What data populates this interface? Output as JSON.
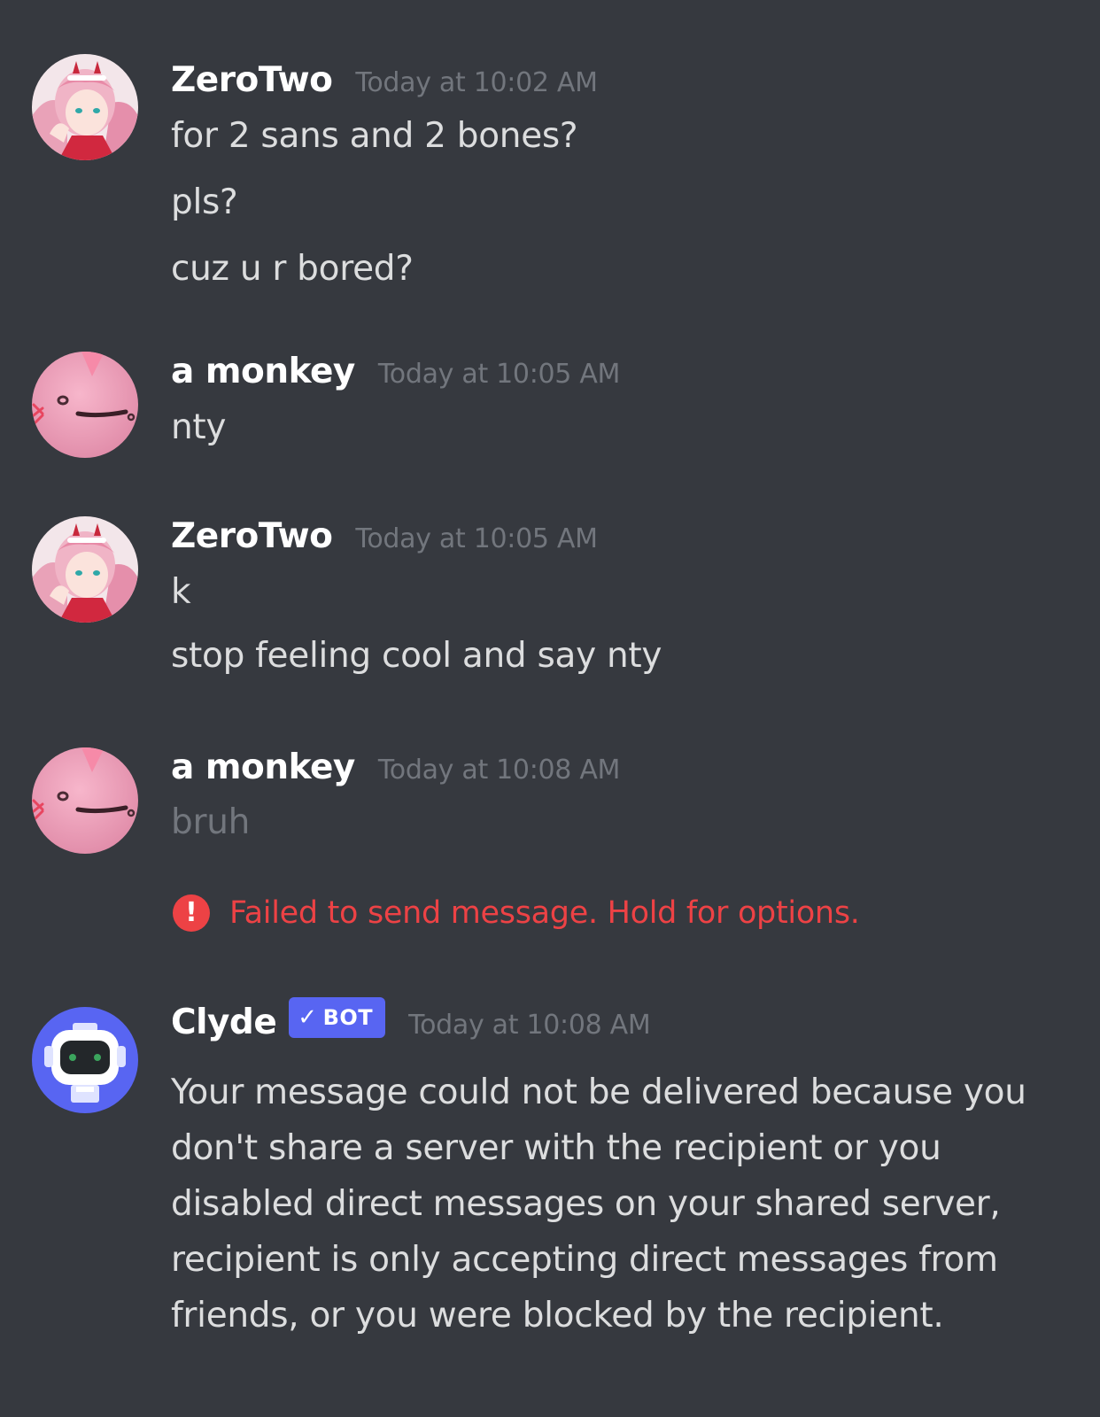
{
  "messages": [
    {
      "author": "ZeroTwo",
      "avatar": "zerotwo-avatar",
      "timestamp": "Today at 10:02 AM",
      "lines": [
        "for 2 sans and 2 bones?",
        "pls?",
        "cuz u r bored?"
      ]
    },
    {
      "author": "a monkey",
      "avatar": "pink-blob-avatar",
      "timestamp": "Today at 10:05 AM",
      "lines": [
        "nty"
      ]
    },
    {
      "author": "ZeroTwo",
      "avatar": "zerotwo-avatar",
      "timestamp": "Today at 10:05 AM",
      "lines": [
        "k",
        "stop feeling cool and say nty"
      ]
    },
    {
      "author": "a monkey",
      "avatar": "pink-blob-avatar",
      "timestamp": "Today at 10:08 AM",
      "lines": [
        "bruh"
      ],
      "error": {
        "icon": "!",
        "text": "Failed to send message. Hold for options."
      }
    },
    {
      "author": "Clyde",
      "avatar": "clyde-robot-avatar",
      "badge": "BOT",
      "timestamp": "Today at 10:08 AM",
      "text": "Your message could not be delivered because you don't share a server with the recipient or you disabled direct messages on your shared server, recipient is only accepting direct messages from friends, or you were blocked by the recipient."
    }
  ],
  "colors": {
    "background": "#36393f",
    "username": "#ffffff",
    "timestamp": "#72767d",
    "message_text": "#dcddde",
    "error": "#ed4245",
    "bot_badge": "#5865f2"
  }
}
